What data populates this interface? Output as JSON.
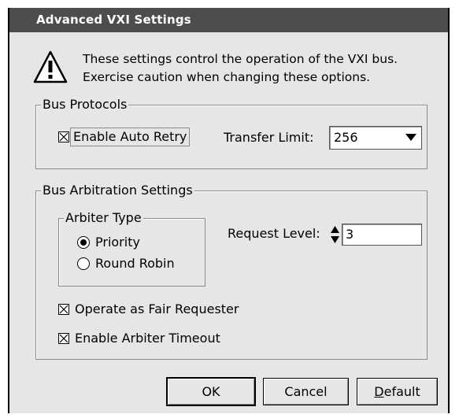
{
  "window": {
    "title": "Advanced VXI Settings"
  },
  "intro": {
    "line1": "These settings control the operation of the VXI bus.",
    "line2": "Exercise caution when changing these options."
  },
  "bus_protocols": {
    "group_label": "Bus Protocols",
    "auto_retry": {
      "label": "Enable Auto Retry",
      "checked": true
    },
    "transfer_limit": {
      "label": "Transfer Limit:",
      "value": "256"
    }
  },
  "bus_arbitration": {
    "group_label": "Bus Arbitration Settings",
    "arbiter_type": {
      "group_label": "Arbiter Type",
      "options": [
        {
          "label": "Priority",
          "selected": true
        },
        {
          "label": "Round Robin",
          "selected": false
        }
      ]
    },
    "request_level": {
      "label": "Request Level:",
      "value": "3"
    },
    "fair_requester": {
      "label": "Operate as Fair Requester",
      "checked": true
    },
    "arbiter_timeout": {
      "label": "Enable Arbiter Timeout",
      "checked": true
    }
  },
  "buttons": {
    "ok": "OK",
    "cancel": "Cancel",
    "default_prefix": "D",
    "default_rest": "efault"
  }
}
